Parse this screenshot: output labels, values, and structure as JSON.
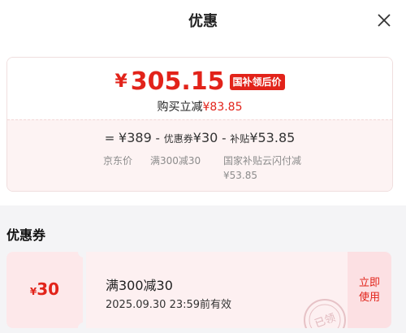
{
  "header": {
    "title": "优惠"
  },
  "price_card": {
    "currency": "¥",
    "final_price": "305.15",
    "badge": "国补领后价",
    "instant_label": "购买立减",
    "instant_amount": "¥83.85",
    "breakdown": {
      "eq": "=",
      "base_price": "¥389",
      "minus1": "-",
      "coupon_label": "优惠券",
      "coupon_amount": "¥30",
      "minus2": "-",
      "subsidy_label": "补贴",
      "subsidy_amount": "¥53.85",
      "base_caption": "京东价",
      "coupon_caption": "满300减30",
      "subsidy_caption_line1": "国家补贴云闪付减",
      "subsidy_caption_line2": "¥53.85"
    }
  },
  "coupons_section": {
    "title": "优惠券",
    "coupons": [
      {
        "currency": "¥",
        "amount": "30",
        "name": "满300减30",
        "expiry": "2025.09.30 23:59前有效",
        "action_label": "立即使用",
        "stamp": "已领"
      }
    ]
  },
  "colors": {
    "accent": "#e2231a",
    "coupon_bg": "#fdf0f1",
    "muted": "#8c8c8c"
  },
  "icons": {
    "close": "close-icon"
  }
}
